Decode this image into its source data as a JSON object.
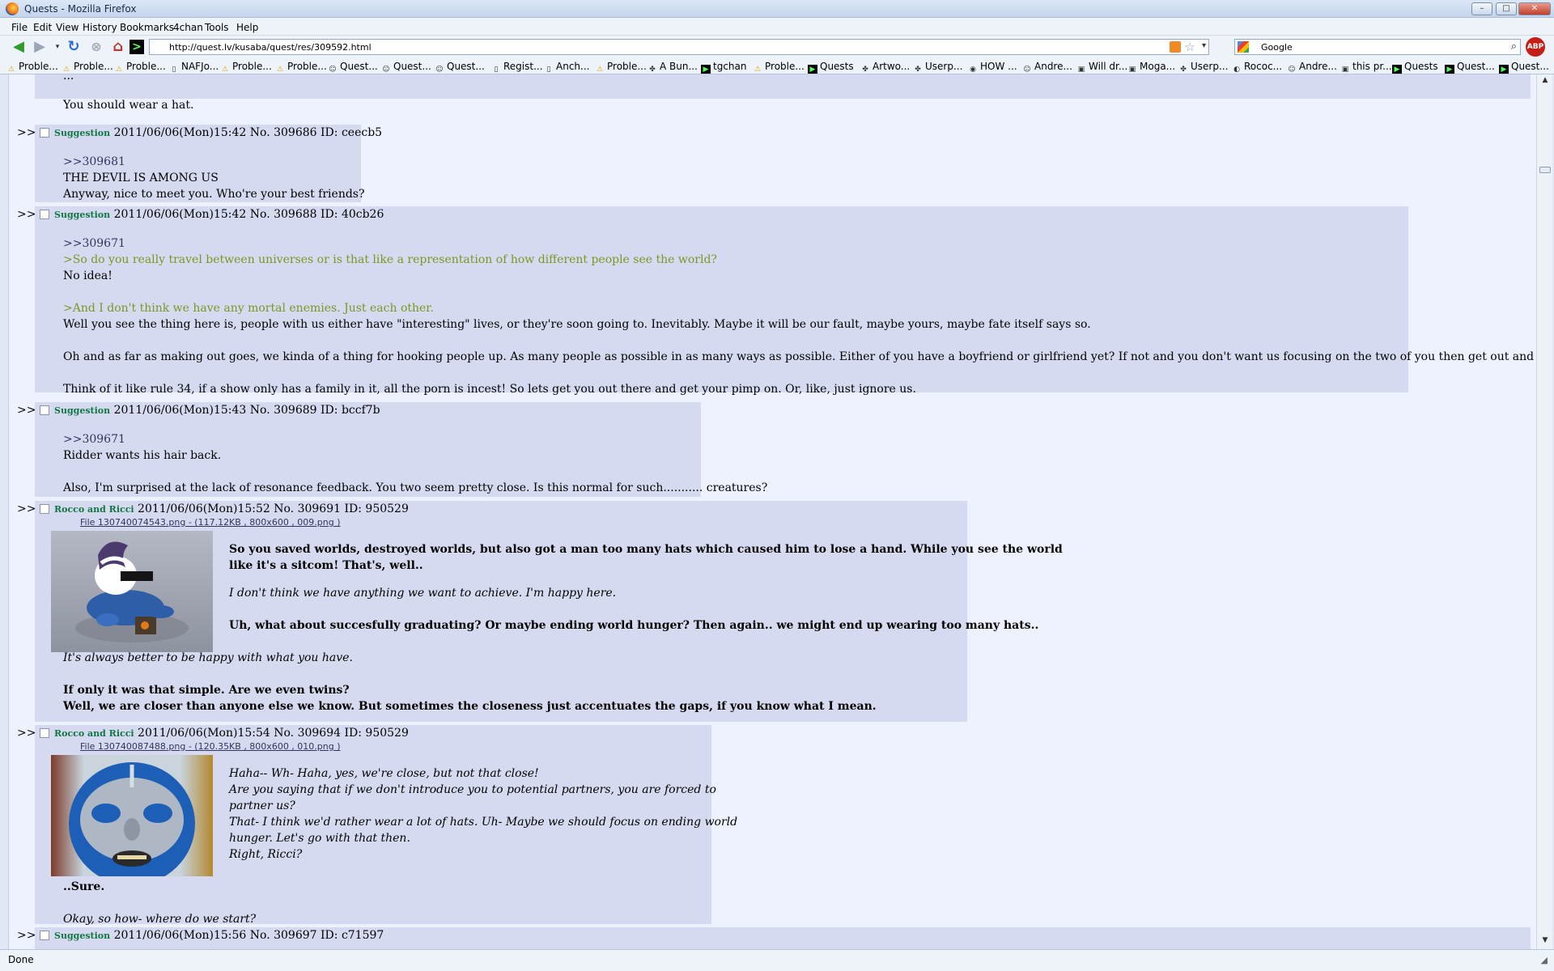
{
  "window": {
    "title": "Quests - Mozilla Firefox",
    "buttons": {
      "minimize": "–",
      "maximize": "□",
      "close": "✕"
    }
  },
  "menu": [
    "File",
    "Edit",
    "View",
    "History",
    "Bookmarks",
    "4chan",
    "Tools",
    "Help"
  ],
  "nav": {
    "url": "http://quest.lv/kusaba/quest/res/309592.html",
    "search_engine_value": "Google",
    "abp_label": "ABP"
  },
  "bookmarks": [
    "Proble...",
    "Proble...",
    "Proble...",
    "NAFJo...",
    "Proble...",
    "Proble...",
    "Quest...",
    "Quest...",
    "Quest...",
    "Regist...",
    "Anch...",
    "Proble...",
    "A Bun...",
    "tgchan",
    "Proble...",
    "Quests",
    "Artwo...",
    "Userp...",
    "HOW ...",
    "Andre...",
    "Will dr...",
    "Moga...",
    "Userp...",
    "Rococ...",
    "Andre...",
    "this pr...",
    "Quests",
    "Quest...",
    "Quest..."
  ],
  "posts": [
    {
      "partial": true,
      "lines": [
        "...",
        "",
        "You should wear a hat."
      ]
    },
    {
      "name": "Suggestion",
      "date": "2011/06/06(Mon)15:42",
      "no": "No. 309686",
      "id": "ID: ceecb5",
      "lines": [
        ">>309681",
        "THE DEVIL IS AMONG US",
        "Anyway, nice to meet you. Who're your best friends?"
      ]
    },
    {
      "name": "Suggestion",
      "date": "2011/06/06(Mon)15:42",
      "no": "No. 309688",
      "id": "ID: 40cb26",
      "lines": [
        ">>309671",
        ">So do you really travel between universes or is that like a representation of how different people see the world?",
        "No idea!",
        "",
        ">And I don't think we have any mortal enemies. Just each other.",
        "Well you see the thing here is, people with us either have \"interesting\" lives, or they're soon going to. Inevitably. Maybe it will be our fault, maybe yours, maybe fate itself says so.",
        "",
        "Oh and as far as making out goes, we kinda of a thing for hooking people up. As many people as possible in as many ways as possible. Either of you have a boyfriend or girlfriend yet? If not and you don't want us focusing on the two of you then get out and meet people.",
        "",
        "Think of it like rule 34, if a show only has a family in it, all the porn is incest! So lets get you out there and get your pimp on. Or, like, just ignore us."
      ]
    },
    {
      "name": "Suggestion",
      "date": "2011/06/06(Mon)15:43",
      "no": "No. 309689",
      "id": "ID: bccf7b",
      "lines": [
        ">>309671",
        "Ridder wants his hair back.",
        "",
        "Also, I'm surprised at the lack of resonance feedback. You two seem pretty close. Is this normal for such........... creatures?"
      ]
    },
    {
      "name": "Rocco and Ricci",
      "date": "2011/06/06(Mon)15:52",
      "no": "No. 309691",
      "id": "ID: 950529",
      "file": "File 130740074543.png - (117.12KB , 800x600 , 009.png )",
      "lines": [
        "So you saved worlds, destroyed worlds, but also got a man too many hats which caused him to lose a hand. While you see the world",
        "like it's a sitcom! That's, well..",
        "",
        "I don't think we have anything we want to achieve. I'm happy here.",
        "",
        "Uh, what about succesfully graduating? Or maybe ending world hunger? Then again.. we might end up wearing too many hats..",
        "",
        "It's always better to be happy with what you have.",
        "",
        "If only it was that simple. Are we even twins?",
        "Well, we are closer than anyone else we know. But sometimes the closeness just accentuates the gaps, if you know what I mean."
      ]
    },
    {
      "name": "Rocco and Ricci",
      "date": "2011/06/06(Mon)15:54",
      "no": "No. 309694",
      "id": "ID: 950529",
      "file": "File 130740087488.png - (120.35KB , 800x600 , 010.png )",
      "lines": [
        "Haha-- Wh- Haha, yes, we're close, but not that close!",
        "Are you saying that if we don't introduce you to potential partners, you are forced to",
        "partner us?",
        "That- I think we'd rather wear a lot of hats. Uh- Maybe we should focus on ending world",
        "hunger. Let's go with that then.",
        "Right, Ricci?",
        "",
        "..Sure.",
        "",
        "Okay, so how- where do we start?"
      ]
    },
    {
      "name": "Suggestion",
      "date": "2011/06/06(Mon)15:56",
      "no": "No. 309697",
      "id": "ID: c71597",
      "lines": []
    }
  ],
  "arrow_marker": ">>",
  "status": "Done",
  "colors": {
    "reply_bg": "#d6daf0",
    "page_bg": "#eef2ff",
    "name": "#117743",
    "greentext": "#789922",
    "quotelink": "#34345c"
  }
}
